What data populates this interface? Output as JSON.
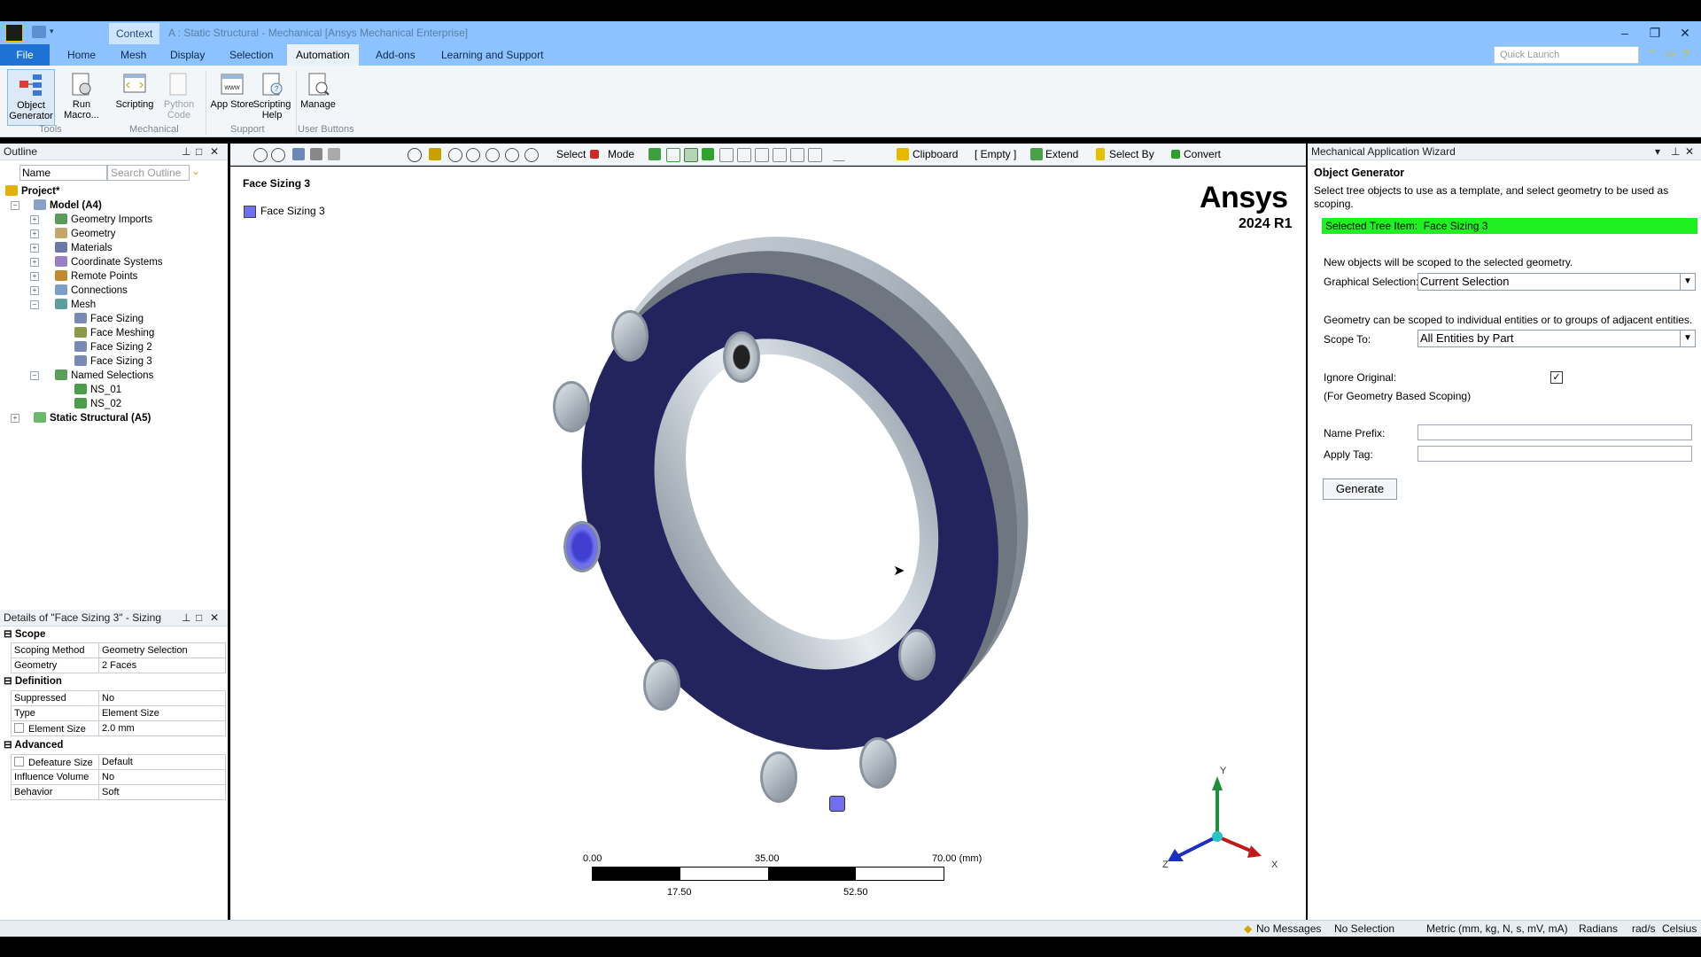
{
  "window": {
    "context_tab": "Context",
    "title": "A : Static Structural - Mechanical [Ansys Mechanical Enterprise]"
  },
  "menu": {
    "file": "File",
    "items": [
      "Home",
      "Mesh",
      "Display",
      "Selection",
      "Automation",
      "Add-ons",
      "Learning and Support"
    ],
    "quick_launch_placeholder": "Quick Launch"
  },
  "ribbon": {
    "buttons": [
      "Object Generator",
      "Run Macro...",
      "Scripting",
      "Python Code",
      "App Store",
      "Scripting Help",
      "Manage"
    ],
    "groups": [
      "Tools",
      "Mechanical",
      "Support",
      "User Buttons"
    ]
  },
  "outline": {
    "title": "Outline",
    "filter_value": "Name",
    "search_placeholder": "Search Outline",
    "tree": [
      {
        "label": "Project*",
        "level": 0
      },
      {
        "label": "Model (A4)",
        "level": 1
      },
      {
        "label": "Geometry Imports",
        "level": 2
      },
      {
        "label": "Geometry",
        "level": 2
      },
      {
        "label": "Materials",
        "level": 2
      },
      {
        "label": "Coordinate Systems",
        "level": 2
      },
      {
        "label": "Remote Points",
        "level": 2
      },
      {
        "label": "Connections",
        "level": 2
      },
      {
        "label": "Mesh",
        "level": 2
      },
      {
        "label": "Face Sizing",
        "level": 3
      },
      {
        "label": "Face Meshing",
        "level": 3
      },
      {
        "label": "Face Sizing 2",
        "level": 3
      },
      {
        "label": "Face Sizing 3",
        "level": 3
      },
      {
        "label": "Named Selections",
        "level": 2
      },
      {
        "label": "NS_01",
        "level": 3
      },
      {
        "label": "NS_02",
        "level": 3
      },
      {
        "label": "Static Structural (A5)",
        "level": 1
      }
    ]
  },
  "details": {
    "title": "Details of \"Face Sizing 3\" - Sizing",
    "sections": {
      "scope": "Scope",
      "definition": "Definition",
      "advanced": "Advanced"
    },
    "rows": {
      "scoping_method": [
        "Scoping Method",
        "Geometry Selection"
      ],
      "geometry": [
        "Geometry",
        "2 Faces"
      ],
      "suppressed": [
        "Suppressed",
        "No"
      ],
      "type": [
        "Type",
        "Element Size"
      ],
      "element_size": [
        "Element Size",
        "2.0 mm"
      ],
      "defeature_size": [
        "Defeature Size",
        "Default"
      ],
      "influence_volume": [
        "Influence Volume",
        "No"
      ],
      "behavior": [
        "Behavior",
        "Soft"
      ]
    }
  },
  "toolbar": {
    "select": "Select",
    "mode": "Mode",
    "clipboard": "Clipboard",
    "empty": "[ Empty ]",
    "extend": "Extend",
    "select_by": "Select By",
    "convert": "Convert"
  },
  "viewport": {
    "title": "Face Sizing 3",
    "legend_label": "Face Sizing 3",
    "legend_color": "#6f6ff0",
    "brand": "Ansys",
    "version": "2024 R1",
    "scale_top": [
      "0.00",
      "35.00",
      "70.00 (mm)"
    ],
    "scale_bottom": [
      "17.50",
      "52.50"
    ],
    "axes": {
      "x": "X",
      "y": "Y",
      "z": "Z"
    }
  },
  "wizard": {
    "title": "Mechanical Application Wizard",
    "heading": "Object Generator",
    "intro": "Select tree objects to use as a template, and select geometry to be used as scoping.",
    "selected_label": "Selected Tree Item:",
    "selected_value": "Face Sizing 3",
    "scoped_note": "New objects will be scoped to the selected geometry.",
    "graphical_label": "Graphical Selection:",
    "graphical_value": "Current Selection",
    "scope_note": "Geometry can be scoped to individual entities or to groups of adjacent entities.",
    "scope_to_label": "Scope To:",
    "scope_to_value": "All Entities by Part",
    "ignore_label": "Ignore Original:",
    "ignore_sub": "(For Geometry Based Scoping)",
    "ignore_checked": true,
    "name_prefix_label": "Name Prefix:",
    "apply_tag_label": "Apply Tag:",
    "generate": "Generate"
  },
  "status": {
    "messages": "No Messages",
    "selection": "No Selection",
    "units": "Metric (mm, kg, N, s, mV, mA)",
    "angle": "Radians",
    "rate": "rad/s",
    "temp": "Celsius"
  }
}
